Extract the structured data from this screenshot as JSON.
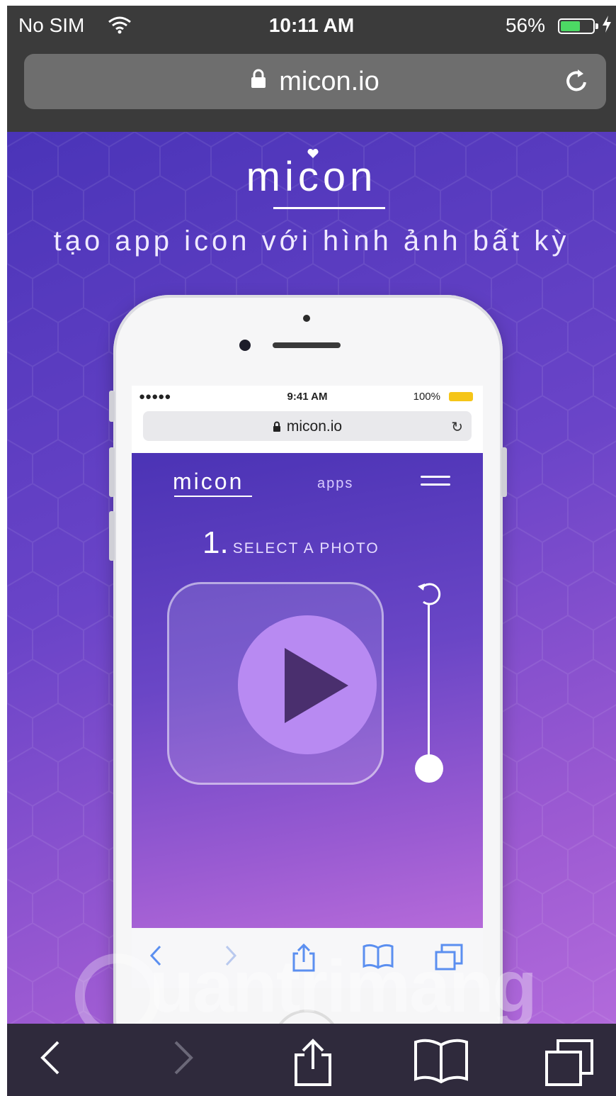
{
  "status_bar": {
    "carrier": "No SIM",
    "time": "10:11 AM",
    "battery_percent": "56%",
    "battery_level": 0.56,
    "icons": [
      "wifi-icon",
      "battery-icon",
      "charging-bolt-icon"
    ]
  },
  "address_bar": {
    "url": "micon.io",
    "icons": [
      "lock-icon",
      "reload-icon"
    ]
  },
  "page": {
    "logo": "micon",
    "tagline": "tạo app icon với hình ảnh bất kỳ"
  },
  "inner_phone": {
    "status": {
      "carrier": "●●●●● ",
      "time": "9:41 AM",
      "battery": "100%"
    },
    "url": "micon.io",
    "site": {
      "logo": "micon",
      "nav_apps": "apps",
      "step_number": "1.",
      "step_label": "SELECT A PHOTO"
    }
  },
  "watermark": "uantrimang",
  "toolbar": {
    "icons": [
      "back-icon",
      "forward-icon",
      "share-icon",
      "bookmarks-icon",
      "tabs-icon"
    ]
  },
  "colors": {
    "gradient_start": "#4a34b8",
    "gradient_end": "#b26adb",
    "play_circle": "#b88af2",
    "battery_green": "#4cd964"
  }
}
